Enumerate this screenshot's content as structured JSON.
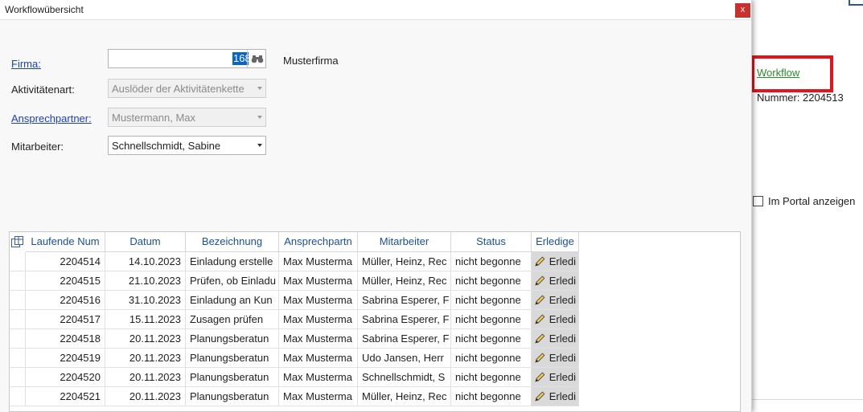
{
  "background": {
    "workflow_link": "Workflow",
    "number_text": "Nummer: 2204513",
    "portal_checkbox_label": "Im Portal anzeigen"
  },
  "dialog": {
    "title": "Workflowübersicht",
    "close_label": "x",
    "form": {
      "firma_label": "Firma:",
      "firma_value": "168",
      "firma_name": "Musterfirma",
      "aktivitaetenart_label": "Aktivitätenart:",
      "aktivitaetenart_value": "Auslöder der Aktivitätenkette",
      "ansprechpartner_label": "Ansprechpartner:",
      "ansprechpartner_value": "Mustermann, Max",
      "mitarbeiter_label": "Mitarbeiter:",
      "mitarbeiter_value": "Schnellschmidt, Sabine"
    },
    "table": {
      "columns": [
        "Laufende Num",
        "Datum",
        "Bezeichnung",
        "Ansprechpartn",
        "Mitarbeiter",
        "Status",
        "Erledige"
      ],
      "rows": [
        {
          "nr": "2204514",
          "datum": "14.10.2023",
          "bez": "Einladung erstelle",
          "ap": "Max Musterma",
          "ma": "Müller, Heinz, Rec",
          "status": "nicht begonne",
          "erl": "Erledi"
        },
        {
          "nr": "2204515",
          "datum": "21.10.2023",
          "bez": "Prüfen, ob Einladu",
          "ap": "Max Musterma",
          "ma": "Müller, Heinz, Rec",
          "status": "nicht begonne",
          "erl": "Erledi"
        },
        {
          "nr": "2204516",
          "datum": "31.10.2023",
          "bez": "Einladung an Kun",
          "ap": "Max Musterma",
          "ma": "Sabrina Esperer, F",
          "status": "nicht begonne",
          "erl": "Erledi"
        },
        {
          "nr": "2204517",
          "datum": "15.11.2023",
          "bez": "Zusagen prüfen",
          "ap": "Max Musterma",
          "ma": "Sabrina Esperer, F",
          "status": "nicht begonne",
          "erl": "Erledi"
        },
        {
          "nr": "2204518",
          "datum": "20.11.2023",
          "bez": "Planungsberatun",
          "ap": "Max Musterma",
          "ma": "Sabrina Esperer, F",
          "status": "nicht begonne",
          "erl": "Erledi"
        },
        {
          "nr": "2204519",
          "datum": "20.11.2023",
          "bez": "Planungsberatun",
          "ap": "Max Musterma",
          "ma": "Udo Jansen, Herr",
          "status": "nicht begonne",
          "erl": "Erledi"
        },
        {
          "nr": "2204520",
          "datum": "20.11.2023",
          "bez": "Planungsberatun",
          "ap": "Max Musterma",
          "ma": "Schnellschmidt, S",
          "status": "nicht begonne",
          "erl": "Erledi"
        },
        {
          "nr": "2204521",
          "datum": "20.11.2023",
          "bez": "Planungsberatun",
          "ap": "Max Musterma",
          "ma": "Müller, Heinz, Rec",
          "status": "nicht begonne",
          "erl": "Erledi"
        }
      ]
    }
  },
  "colors": {
    "accent_link": "#1a3ec8",
    "highlight_box": "#e3141b",
    "selection": "#0a64d0",
    "workflow_link": "#2a8c2a"
  }
}
